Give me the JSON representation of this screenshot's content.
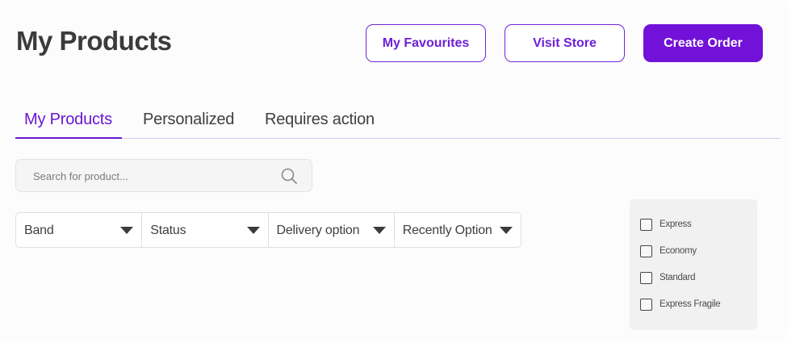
{
  "header": {
    "title": "My Products",
    "buttons": {
      "favourites": "My Favourites",
      "visit_store": "Visit Store",
      "create_order": "Create Order"
    }
  },
  "tabs": [
    {
      "label": "My Products",
      "active": true
    },
    {
      "label": "Personalized",
      "active": false
    },
    {
      "label": "Requires action",
      "active": false
    }
  ],
  "search": {
    "placeholder": "Search for product...",
    "value": ""
  },
  "filters": [
    {
      "label": "Band"
    },
    {
      "label": "Status"
    },
    {
      "label": "Delivery option"
    },
    {
      "label": "Recently Option"
    }
  ],
  "delivery_checkboxes": [
    {
      "label": "Express",
      "checked": false
    },
    {
      "label": "Economy",
      "checked": false
    },
    {
      "label": "Standard",
      "checked": false
    },
    {
      "label": "Express Fragile",
      "checked": false
    }
  ],
  "icons": {
    "search": "search-icon",
    "dropdown": "caret-down-icon",
    "checkbox": "checkbox-icon"
  },
  "colors": {
    "accent": "#7211d8",
    "accent_text": "#6a18cf",
    "panel_bg": "#f1f1f1"
  }
}
